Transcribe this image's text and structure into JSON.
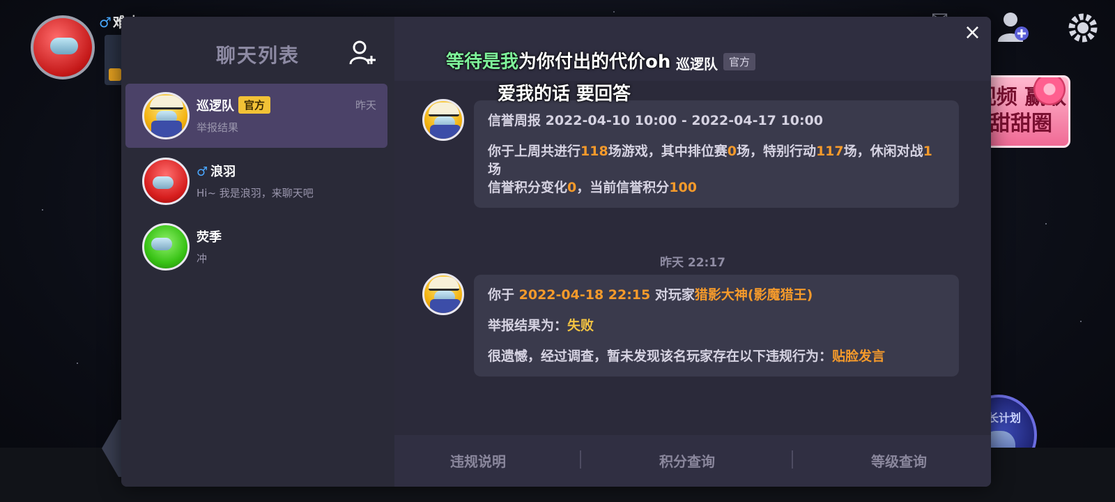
{
  "background": {
    "player_name": "难忠",
    "gender_symbol": "♂",
    "promo_text": "视频 赢取甜甜圈",
    "growth_plan_label": "成长计划"
  },
  "sidebar": {
    "title": "聊天列表",
    "add_friend_icon": "add-user-icon",
    "contacts": [
      {
        "name": "巡逻队",
        "tag": "官方",
        "preview": "举报结果",
        "time": "昨天",
        "avatar": "yellow-crewmate-with-cap",
        "gender": ""
      },
      {
        "name": "浪羽",
        "tag": "",
        "preview": "Hi~ 我是浪羽，来聊天吧",
        "time": "",
        "avatar": "red-crewmate",
        "gender": "♂"
      },
      {
        "name": "荧季",
        "tag": "",
        "preview": "冲",
        "time": "",
        "avatar": "green-crewmate",
        "gender": ""
      }
    ]
  },
  "chat": {
    "header_name": "巡逻队",
    "header_tag": "官方",
    "close_symbol": "×",
    "messages": [
      {
        "report_title": "信誉周报 2022-04-10 10:00 - 2022-04-17 10:00",
        "line1_a": "你于上周共进行",
        "total_games": "118",
        "line1_b": "场游戏，其中排位赛",
        "ranked_games": "0",
        "line1_c": "场，特别行动",
        "special_games": "117",
        "line1_d": "场，休闲对战",
        "casual_games": "1",
        "line1_e": "场",
        "line2_a": "信誉积分变化",
        "score_change": "0",
        "line2_b": "，当前信誉积分",
        "current_score": "100"
      },
      {
        "p1_a": "你于 ",
        "report_time": "2022-04-18 22:15",
        "p1_b": " 对玩家",
        "target_player": "猎影大神(影魔猎王)",
        "p2_a": "举报结果为：",
        "result": "失败",
        "p3_a": "很遗憾，经过调查，暂未发现该名玩家存在以下违规行为：",
        "violation": "贴脸发言"
      }
    ],
    "time_separator": "昨天 22:17",
    "footer_buttons": [
      "违规说明",
      "积分查询",
      "等级查询"
    ]
  },
  "lyrics": {
    "line1_sung": "等待是我",
    "line1_rest": "为你付出的代价",
    "line1_ghost": "oh",
    "line2": "爱我的话 要回答"
  },
  "colors": {
    "modal_bg": "#2b2a3a",
    "active_contact": "#4b4268",
    "highlight_orange": "#f59a2b",
    "official_tag": "#f2c236",
    "lyric_sung": "#7ef29a"
  }
}
